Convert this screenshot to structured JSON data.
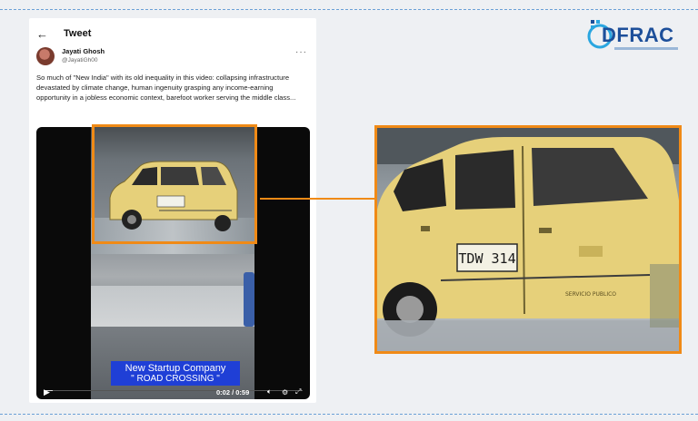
{
  "tweet": {
    "header_title": "Tweet",
    "author_name": "Jayati Ghosh",
    "author_handle": "@JayatiGh00",
    "text": "So much of \"New India\" with its old inequality in this video: collapsing infrastructure devastated by climate change, human ingenuity grasping any income-earning opportunity in a jobless economic context, barefoot worker serving the middle class..."
  },
  "video": {
    "caption_line1": "New Startup Company",
    "caption_line2": "\" ROAD CROSSING \"",
    "time": "0:02 / 0:59",
    "progress": 0.034
  },
  "taxi": {
    "plate": "TDW 314",
    "side_text": "SERVICIO PUBLICO"
  },
  "logo": {
    "text": "DFRAC"
  },
  "colors": {
    "highlight": "#f08a16",
    "caption_bg": "#1f3fd6",
    "taxi_yellow": "#e8d37a",
    "logo_blue": "#1d4f9a"
  },
  "icons": [
    "back-arrow-icon",
    "more-icon",
    "play-icon",
    "volume-icon",
    "settings-icon",
    "fullscreen-icon"
  ]
}
